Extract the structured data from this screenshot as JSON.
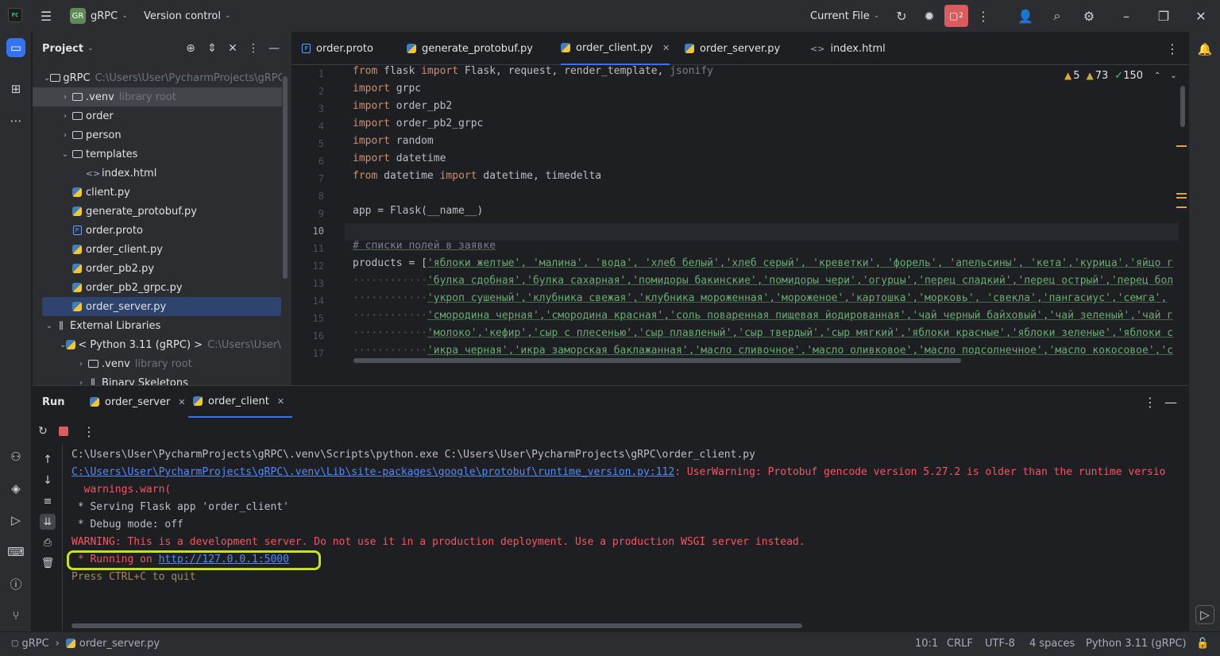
{
  "titlebar": {
    "project_badge": "GR",
    "project_name": "gRPC",
    "vcs": "Version control",
    "run_config": "Current File",
    "run_badge": "2"
  },
  "project_panel": {
    "title": "Project",
    "tree": [
      {
        "label": "gRPC",
        "hint": "C:\\Users\\User\\PycharmProjects\\gRPC",
        "type": "folder",
        "depth": 0,
        "expanded": true
      },
      {
        "label": ".venv",
        "hint": "library root",
        "type": "folder",
        "depth": 1,
        "expanded": false
      },
      {
        "label": "order",
        "hint": "",
        "type": "folder",
        "depth": 1,
        "expanded": false
      },
      {
        "label": "person",
        "hint": "",
        "type": "folder",
        "depth": 1,
        "expanded": false
      },
      {
        "label": "templates",
        "hint": "",
        "type": "folder",
        "depth": 1,
        "expanded": true
      },
      {
        "label": "index.html",
        "hint": "",
        "type": "html",
        "depth": 2
      },
      {
        "label": "client.py",
        "hint": "",
        "type": "py",
        "depth": 1
      },
      {
        "label": "generate_protobuf.py",
        "hint": "",
        "type": "py",
        "depth": 1
      },
      {
        "label": "order.proto",
        "hint": "",
        "type": "proto",
        "depth": 1
      },
      {
        "label": "order_client.py",
        "hint": "",
        "type": "py",
        "depth": 1
      },
      {
        "label": "order_pb2.py",
        "hint": "",
        "type": "py",
        "depth": 1
      },
      {
        "label": "order_pb2_grpc.py",
        "hint": "",
        "type": "py",
        "depth": 1
      },
      {
        "label": "order_server.py",
        "hint": "",
        "type": "py",
        "depth": 1,
        "selected": true
      },
      {
        "label": "External Libraries",
        "hint": "",
        "type": "lib",
        "depth": 0,
        "expanded": true
      },
      {
        "label": "< Python 3.11 (gRPC) >",
        "hint": "C:\\Users\\User\\Py",
        "type": "py",
        "depth": 1,
        "expanded": true
      },
      {
        "label": ".venv",
        "hint": "library root",
        "type": "folder",
        "depth": 2,
        "expanded": false
      },
      {
        "label": "Binary Skeletons",
        "hint": "",
        "type": "lib",
        "depth": 2,
        "expanded": false
      }
    ]
  },
  "editor": {
    "tabs": [
      {
        "label": "order.proto",
        "type": "proto"
      },
      {
        "label": "generate_protobuf.py",
        "type": "py"
      },
      {
        "label": "order_client.py",
        "type": "py",
        "active": true
      },
      {
        "label": "order_server.py",
        "type": "py"
      },
      {
        "label": "index.html",
        "type": "html"
      }
    ],
    "inspections": {
      "warnings": "5",
      "weak_warnings": "73",
      "ok": "150"
    },
    "current_line": "10",
    "lines": [
      "1",
      "2",
      "3",
      "4",
      "5",
      "6",
      "7",
      "8",
      "9",
      "10",
      "11",
      "12",
      "13",
      "14",
      "15",
      "16",
      "17"
    ],
    "code": {
      "l1a": "from",
      "l1b": " flask ",
      "l1c": "import",
      "l1d": " Flask, request, render_template, ",
      "l1e": "jsonify",
      "l2a": "import",
      "l2b": " grpc",
      "l3a": "import",
      "l3b": " order_pb2",
      "l4a": "import",
      "l4b": " order_pb2_grpc",
      "l5a": "import",
      "l5b": " random",
      "l6a": "import",
      "l6b": " datetime",
      "l7a": "from",
      "l7b": " datetime ",
      "l7c": "import",
      "l7d": " datetime, timedelta",
      "l9": "app = Flask(__name__)",
      "l11": "# списки полей в заявке",
      "l12a": "products = [",
      "l12b": "'яблоки желтые', 'малина', 'вода', 'хлеб белый','хлеб серый', 'креветки', 'форель', 'апельсины', 'кета','курица','яйцо г",
      "l13": "'булка сдобная','булка сахарная','помидоры бакинские','помидоры чери','огурцы','перец сладкий','перец острый','перец бол",
      "l14": "'укроп сушеный','клубника свежая','клубника мороженная','мороженое','картошка','морковь', 'свекла','пангасиус','семга',",
      "l15": "'смородина черная','смородина красная','соль поваренная пищевая йодированная','чай черный байховый','чай зеленый','чай г",
      "l16": "'молоко','кефир','сыр с плесенью','сыр плавленый','сыр твердый','сыр мягкий','яблоки красные','яблоки зеленые','яблоки с",
      "l17": "'икра черная','икра заморская баклажанная','масло сливочное','масло оливковое','масло подсолнечное','масло кокосовое','с",
      "indent": "············"
    }
  },
  "run_panel": {
    "title": "Run",
    "tabs": [
      {
        "label": "order_server"
      },
      {
        "label": "order_client",
        "active": true
      }
    ],
    "console": {
      "c1": "C:\\Users\\User\\PycharmProjects\\gRPC\\.venv\\Scripts\\python.exe C:\\Users\\User\\PycharmProjects\\gRPC\\order_client.py",
      "c2_link": "C:\\Users\\User\\PycharmProjects\\gRPC\\.venv\\Lib\\site-packages\\google\\protobuf\\runtime_version.py:112",
      "c2_rest": ": UserWarning: Protobuf gencode version 5.27.2 is older than the runtime versio",
      "c3": "  warnings.warn(",
      "c4": " * Serving Flask app 'order_client'",
      "c5": " * Debug mode: off",
      "c6": "WARNING: This is a development server. Do not use it in a production deployment. Use a production WSGI server instead.",
      "c7a": " * Running on ",
      "c7_link": "http://127.0.0.1:5000",
      "c8": "Press CTRL+C to quit"
    }
  },
  "statusbar": {
    "crumb_project": "gRPC",
    "crumb_file": "order_server.py",
    "position": "10:1",
    "line_sep": "CRLF",
    "encoding": "UTF-8",
    "indent": "4 spaces",
    "interpreter": "Python 3.11 (gRPC)"
  },
  "colors": {
    "accent": "#3574f0",
    "highlight_box": "#c8e11a",
    "error_red": "#f75464",
    "string_green": "#6aab73",
    "keyword_orange": "#cf8e6d"
  }
}
